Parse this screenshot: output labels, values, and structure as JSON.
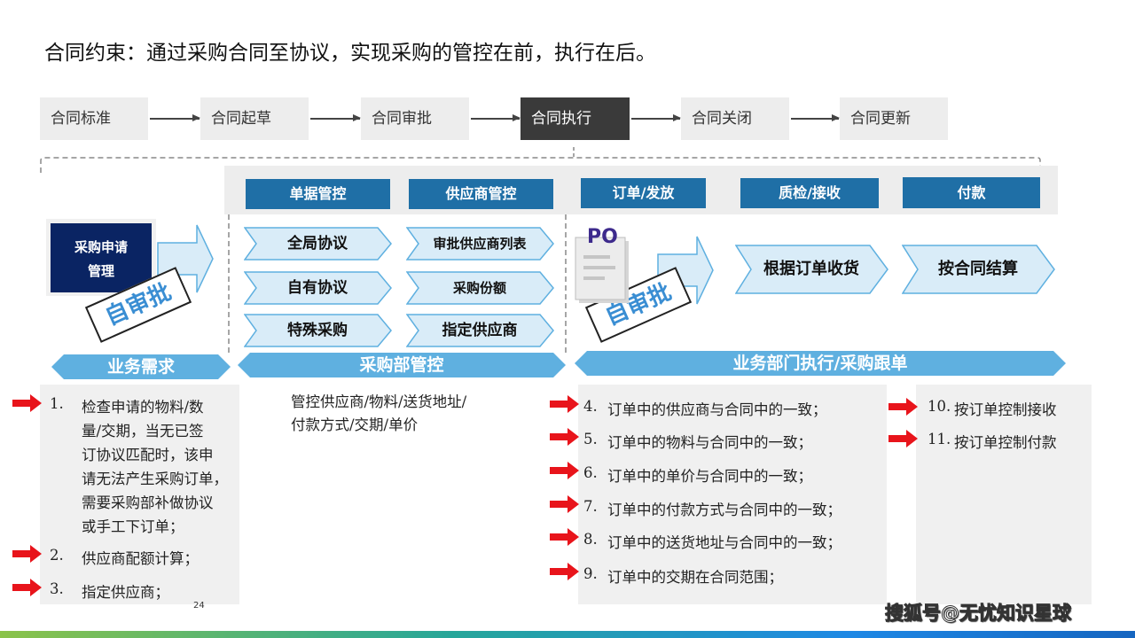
{
  "title": "合同约束：通过采购合同至协议，实现采购的管控在前，执行在后。",
  "flow_steps": [
    "合同标准",
    "合同起草",
    "合同审批",
    "合同执行",
    "合同关闭",
    "合同更新"
  ],
  "header_boxes": [
    "单据管控",
    "供应商管控",
    "订单/发放",
    "质检/接收",
    "付款"
  ],
  "left_box": {
    "line1": "采购申请",
    "line2": "管理"
  },
  "stamp_text": "自审批",
  "chevrons_left": [
    "全局协议",
    "自有协议",
    "特殊采购"
  ],
  "chevrons_right": [
    "审批供应商列表",
    "采购份额",
    "指定供应商"
  ],
  "po_label": "PO",
  "chevrons_exec": [
    "根据订单收货",
    "按合同结算"
  ],
  "sections": [
    "业务需求",
    "采购部管控",
    "业务部门执行/采购跟单"
  ],
  "left_list": [
    {
      "num": "1.",
      "lines": [
        "检查申请的物料/数",
        "量/交期，当无已签",
        "订协议匹配时，该申",
        "请无法产生采购订单，",
        "需要采购部补做协议",
        "或手工下订单；"
      ]
    },
    {
      "num": "2.",
      "lines": [
        "供应商配额计算；"
      ]
    },
    {
      "num": "3.",
      "lines": [
        "指定供应商；"
      ]
    }
  ],
  "mid_text": {
    "line1": "管控供应商/物料/送货地址/",
    "line2": "付款方式/交期/单价"
  },
  "exec_list": [
    {
      "num": "4.",
      "text": "订单中的供应商与合同中的一致；"
    },
    {
      "num": "5.",
      "text": "订单中的物料与合同中的一致；"
    },
    {
      "num": "6.",
      "text": "订单中的单价与合同中的一致；"
    },
    {
      "num": "7.",
      "text": "订单中的付款方式与合同中的一致；"
    },
    {
      "num": "8.",
      "text": "订单中的送货地址与合同中的一致；"
    },
    {
      "num": "9.",
      "text": "订单中的交期在合同范围；"
    }
  ],
  "right_list": [
    {
      "num": "10.",
      "text": "按订单控制接收"
    },
    {
      "num": "11.",
      "text": "按订单控制付款"
    }
  ],
  "page_number": "24",
  "watermark": "搜狐号@无忧知识星球",
  "colors": {
    "blue_header": "#1f6fa6",
    "navy_box": "#0a2463",
    "light_blue": "#5fb0e0",
    "red_arrow": "#e8141b",
    "stamp_text": "#3a8ed3"
  }
}
